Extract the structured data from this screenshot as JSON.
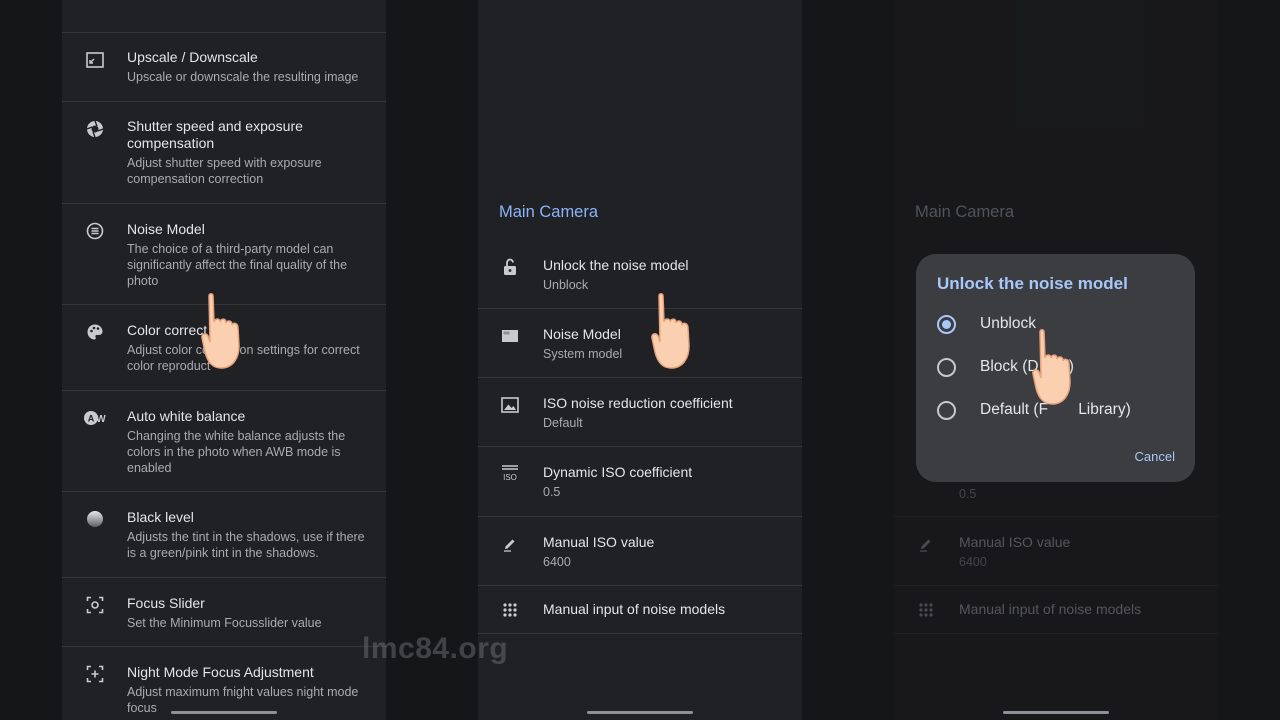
{
  "left_panel": {
    "items": [
      {
        "title": "Upscale / Downscale",
        "subtitle": "Upscale or downscale the resulting image",
        "icon": "resize-icon"
      },
      {
        "title": "Shutter speed and exposure compensation",
        "subtitle": "Adjust shutter speed with exposure compensation correction",
        "icon": "aperture-icon"
      },
      {
        "title": "Noise Model",
        "subtitle": "The choice of a third-party model can significantly affect the final quality of the photo",
        "icon": "list-circle-icon"
      },
      {
        "title": "Color correct",
        "subtitle": "Adjust color co        ion settings for correct color reproduct",
        "icon": "palette-icon"
      },
      {
        "title": "Auto white balance",
        "subtitle": "Changing the white balance adjusts the colors in the photo when AWB mode is enabled",
        "icon": "awb-icon"
      },
      {
        "title": "Black level",
        "subtitle": "Adjusts the tint in the shadows, use if there is a green/pink tint in the shadows.",
        "icon": "gradient-circle-icon"
      },
      {
        "title": "Focus Slider",
        "subtitle": "Set the Minimum Focusslider value",
        "icon": "focus-frame-icon"
      },
      {
        "title": "Night Mode Focus Adjustment",
        "subtitle": "Adjust maximum fnight values night mode focus",
        "icon": "focus-plus-icon"
      }
    ]
  },
  "middle_panel": {
    "section_title": "Main Camera",
    "items": [
      {
        "title": "Unlock the noise model",
        "subtitle": "Unblock",
        "icon": "lock-open-icon"
      },
      {
        "title": "Noise Model",
        "subtitle": "System model",
        "icon": "panel-icon"
      },
      {
        "title": "ISO noise reduction coefficient",
        "subtitle": "Default",
        "icon": "image-icon"
      },
      {
        "title": "Dynamic ISO coefficient",
        "subtitle": "0.5",
        "icon": "iso-icon"
      },
      {
        "title": "Manual ISO value",
        "subtitle": "6400",
        "icon": "pencil-icon"
      },
      {
        "title": "Manual input of noise models",
        "subtitle": "",
        "icon": "grid-dots-icon"
      }
    ]
  },
  "right_panel": {
    "section_title": "Main Camera",
    "bg_items": [
      {
        "title": "",
        "subtitle": "0.5"
      },
      {
        "title": "Manual ISO value",
        "subtitle": "6400"
      },
      {
        "title": "Manual input of noise models",
        "subtitle": ""
      }
    ],
    "dialog": {
      "title": "Unlock the noise model",
      "options": [
        {
          "label": "Unblock",
          "selected": true
        },
        {
          "label": "Block (D      t)",
          "selected": false
        },
        {
          "label": "Default (F       Library)",
          "selected": false
        }
      ],
      "cancel_label": "Cancel"
    }
  },
  "watermark": "lmc84.org",
  "colors": {
    "accent": "#8ab4f8",
    "dialog_accent": "#a8c7fa",
    "panel_bg": "#202124",
    "page_bg": "#151618"
  }
}
